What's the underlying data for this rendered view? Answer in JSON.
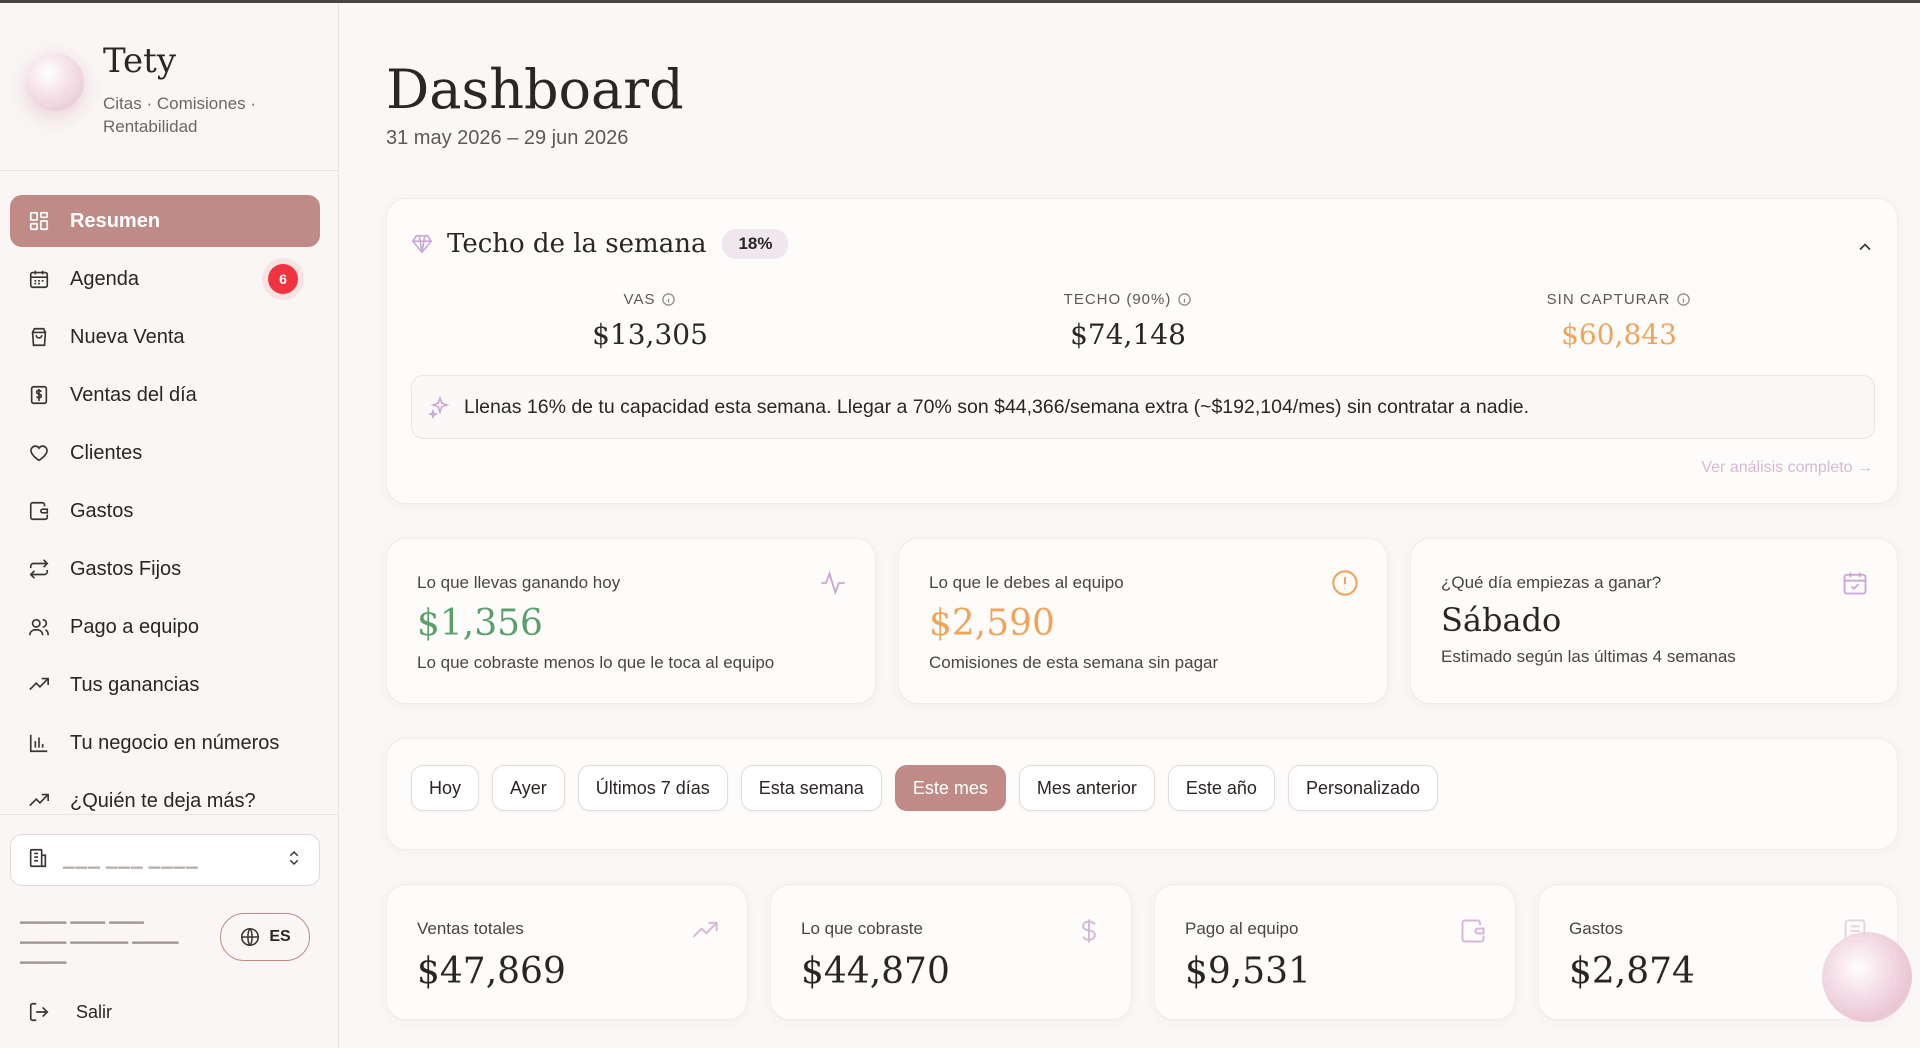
{
  "brand": {
    "name": "Tety",
    "subtitle": "Citas · Comisiones · Rentabilidad"
  },
  "nav": [
    {
      "label": "Resumen",
      "icon": "grid-icon",
      "active": true
    },
    {
      "label": "Agenda",
      "icon": "calendar-icon",
      "badge": "6"
    },
    {
      "label": "Nueva Venta",
      "icon": "shopping-bag-icon"
    },
    {
      "label": "Ventas del día",
      "icon": "receipt-dollar-icon"
    },
    {
      "label": "Clientes",
      "icon": "heart-icon"
    },
    {
      "label": "Gastos",
      "icon": "wallet-icon"
    },
    {
      "label": "Gastos Fijos",
      "icon": "repeat-icon"
    },
    {
      "label": "Pago a equipo",
      "icon": "users-icon"
    },
    {
      "label": "Tus ganancias",
      "icon": "trending-up-icon"
    },
    {
      "label": "Tu negocio en números",
      "icon": "bar-chart-icon"
    },
    {
      "label": "¿Quién te deja más?",
      "icon": "trending-up-icon"
    }
  ],
  "sidebar": {
    "lang_label": "ES",
    "logout_label": "Salir"
  },
  "header": {
    "title": "Dashboard",
    "date_range": "31 may 2026 – 29 jun 2026"
  },
  "techo": {
    "title": "Techo de la semana",
    "percent": "18%",
    "metrics": [
      {
        "label": "VAS",
        "value": "$13,305"
      },
      {
        "label": "TECHO (90%)",
        "value": "$74,148"
      },
      {
        "label": "SIN CAPTURAR",
        "value": "$60,843",
        "color": "#f0a45a"
      }
    ],
    "insight": "Llenas 16% de tu capacidad esta semana. Llegar a 70% son $44,366/semana extra (~$192,104/mes) sin contratar a nadie.",
    "link": "Ver análisis completo →"
  },
  "stats": [
    {
      "label": "Lo que llevas ganando hoy",
      "value": "$1,356",
      "sub": "Lo que cobraste menos lo que le toca al equipo",
      "icon": "activity-icon",
      "color": "#5aa06a"
    },
    {
      "label": "Lo que le debes al equipo",
      "value": "$2,590",
      "sub": "Comisiones de esta semana sin pagar",
      "icon": "alert-circle-icon",
      "color": "#f0a45a"
    },
    {
      "label": "¿Qué día empiezas a ganar?",
      "value": "Sábado",
      "sub": "Estimado según las últimas 4 semanas",
      "icon": "calendar-check-icon"
    }
  ],
  "filters": [
    {
      "label": "Hoy"
    },
    {
      "label": "Ayer"
    },
    {
      "label": "Últimos 7 días"
    },
    {
      "label": "Esta semana"
    },
    {
      "label": "Este mes",
      "active": true
    },
    {
      "label": "Mes anterior"
    },
    {
      "label": "Este año"
    },
    {
      "label": "Personalizado"
    }
  ],
  "kpis": [
    {
      "label": "Ventas totales",
      "value": "$47,869",
      "icon": "trending-up-icon"
    },
    {
      "label": "Lo que cobraste",
      "value": "$44,870",
      "icon": "dollar-icon"
    },
    {
      "label": "Pago al equipo",
      "value": "$9,531",
      "icon": "wallet-icon"
    },
    {
      "label": "Gastos",
      "value": "$2,874",
      "icon": "receipt-icon"
    }
  ],
  "colors": {
    "accent": "#c08b86",
    "badge": "#ef3340",
    "lavender": "#c9a8d6",
    "orange": "#f0a45a",
    "green": "#5aa06a"
  }
}
